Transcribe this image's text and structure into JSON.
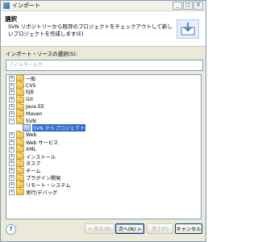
{
  "window": {
    "title": "インポート"
  },
  "header": {
    "title": "選択",
    "description": "SVN リポジトリーから既存のプロジェクトをチェックアウトして新しいプロジェクトを作成します(E)"
  },
  "source": {
    "label": "インポート・ソースの選択(S):",
    "filter_placeholder": "フィルター入力"
  },
  "tree": {
    "items": [
      {
        "label": "一般",
        "expander": "+"
      },
      {
        "label": "CVS",
        "expander": "+"
      },
      {
        "label": "EJB",
        "expander": "+"
      },
      {
        "label": "Git",
        "expander": "+"
      },
      {
        "label": "Java EE",
        "expander": "+"
      },
      {
        "label": "Maven",
        "expander": "+"
      },
      {
        "label": "SVN",
        "expander": "−"
      },
      {
        "label": "SVN からプロジェクト",
        "expander": ""
      },
      {
        "label": "Web",
        "expander": "+"
      },
      {
        "label": "Web サービス",
        "expander": "+"
      },
      {
        "label": "XML",
        "expander": "+"
      },
      {
        "label": "インストール",
        "expander": "+"
      },
      {
        "label": "タスク",
        "expander": "+"
      },
      {
        "label": "チーム",
        "expander": "+"
      },
      {
        "label": "プラグイン開発",
        "expander": "+"
      },
      {
        "label": "リモート・システム",
        "expander": "+"
      },
      {
        "label": "実行/デバッグ",
        "expander": "+"
      }
    ]
  },
  "buttons": {
    "back": "< 戻る(B)",
    "next": "次へ(N) >",
    "finish": "完了(F)",
    "cancel": "キャンセル"
  },
  "help": {
    "label": "?"
  },
  "titlebar": {
    "min": "_",
    "max": "□",
    "close": "X"
  }
}
